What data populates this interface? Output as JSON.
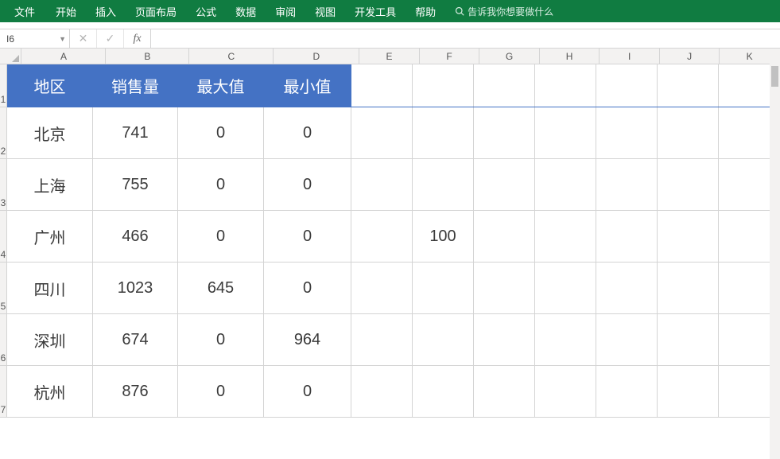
{
  "ribbon": {
    "tabs": [
      "文件",
      "开始",
      "插入",
      "页面布局",
      "公式",
      "数据",
      "审阅",
      "视图",
      "开发工具",
      "帮助"
    ],
    "tell_me": "告诉我你想要做什么"
  },
  "formula_bar": {
    "name_box": "I6",
    "cancel": "✕",
    "enter": "✓",
    "fx": "fx",
    "formula": ""
  },
  "columns": [
    "A",
    "B",
    "C",
    "D",
    "E",
    "F",
    "G",
    "H",
    "I",
    "J",
    "K"
  ],
  "rows": [
    "1",
    "2",
    "3",
    "4",
    "5",
    "6",
    "7"
  ],
  "table": {
    "headers": [
      "地区",
      "销售量",
      "最大值",
      "最小值"
    ],
    "data": [
      [
        "北京",
        "741",
        "0",
        "0"
      ],
      [
        "上海",
        "755",
        "0",
        "0"
      ],
      [
        "广州",
        "466",
        "0",
        "0"
      ],
      [
        "四川",
        "1023",
        "645",
        "0"
      ],
      [
        "深圳",
        "674",
        "0",
        "964"
      ],
      [
        "杭州",
        "876",
        "0",
        "0"
      ]
    ]
  },
  "extras": {
    "F4": "100"
  }
}
